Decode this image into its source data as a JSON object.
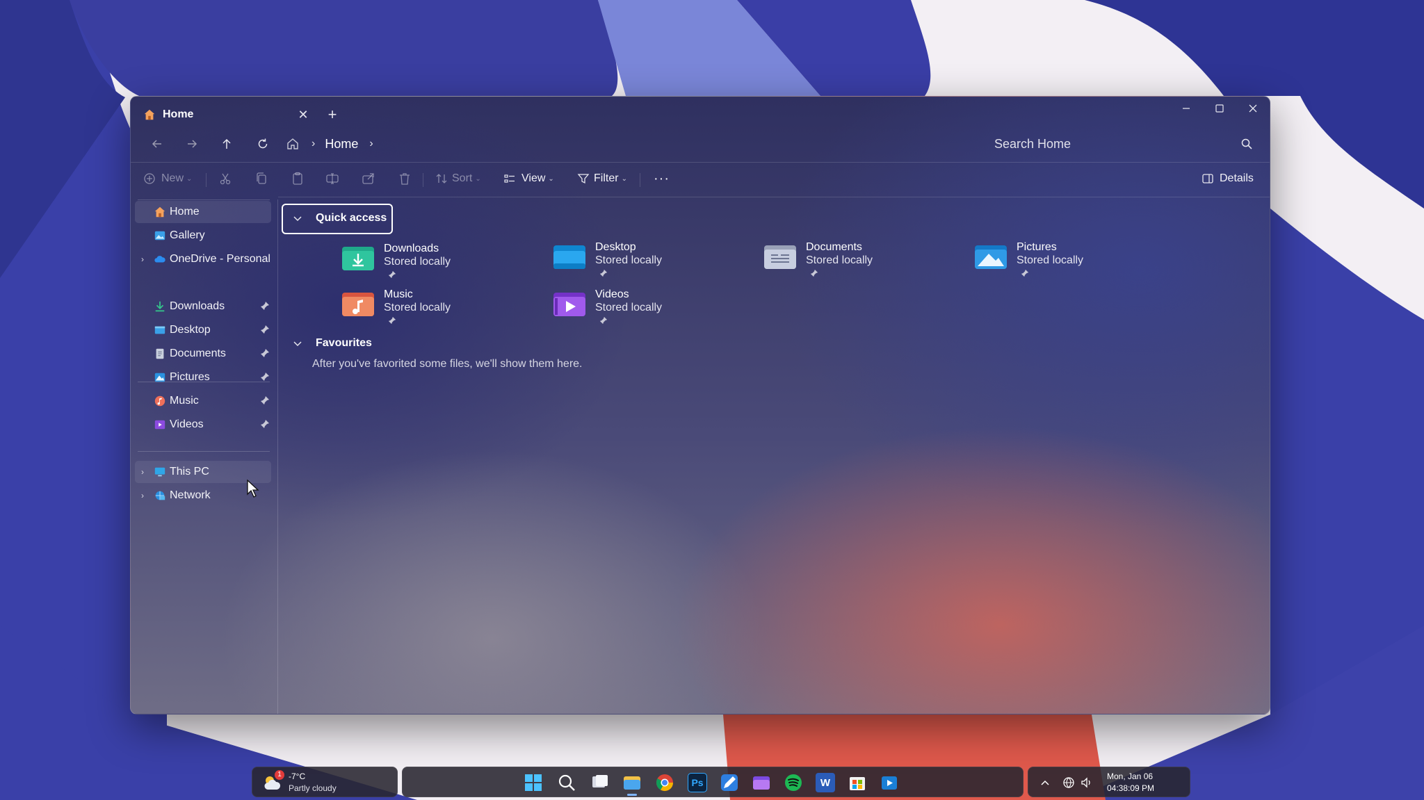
{
  "window": {
    "tab_title": "Home",
    "tab_close": "✕",
    "new_tab": "+",
    "minimize": "—",
    "maximize": "☐",
    "close": "✕"
  },
  "address": {
    "breadcrumb": [
      "Home"
    ],
    "search_placeholder": "Search Home"
  },
  "toolbar": {
    "new_label": "New",
    "sort_label": "Sort",
    "view_label": "View",
    "filter_label": "Filter",
    "more_label": "···",
    "details_label": "Details"
  },
  "sidebar": {
    "top": [
      {
        "label": "Home",
        "icon": "home-icon"
      },
      {
        "label": "Gallery",
        "icon": "gallery-icon"
      },
      {
        "label": "OneDrive - Personal",
        "icon": "onedrive-icon"
      }
    ],
    "pinned": [
      {
        "label": "Downloads",
        "icon": "downloads-icon"
      },
      {
        "label": "Desktop",
        "icon": "desktop-icon"
      },
      {
        "label": "Documents",
        "icon": "documents-icon"
      },
      {
        "label": "Pictures",
        "icon": "pictures-icon"
      },
      {
        "label": "Music",
        "icon": "music-icon"
      },
      {
        "label": "Videos",
        "icon": "videos-icon"
      }
    ],
    "bottom": [
      {
        "label": "This PC",
        "icon": "this-pc-icon"
      },
      {
        "label": "Network",
        "icon": "network-icon"
      }
    ]
  },
  "quick_access": {
    "title": "Quick access",
    "items": [
      {
        "name": "Downloads",
        "status": "Stored locally",
        "icon": "downloads-folder-icon"
      },
      {
        "name": "Desktop",
        "status": "Stored locally",
        "icon": "desktop-folder-icon"
      },
      {
        "name": "Documents",
        "status": "Stored locally",
        "icon": "documents-folder-icon"
      },
      {
        "name": "Pictures",
        "status": "Stored locally",
        "icon": "pictures-folder-icon"
      },
      {
        "name": "Music",
        "status": "Stored locally",
        "icon": "music-folder-icon"
      },
      {
        "name": "Videos",
        "status": "Stored locally",
        "icon": "videos-folder-icon"
      }
    ]
  },
  "favourites": {
    "title": "Favourites",
    "empty_text": "After you've favorited some files, we'll show them here."
  },
  "taskbar": {
    "weather_badge": "1",
    "weather_temp": "-7°C",
    "weather_condition": "Partly cloudy",
    "apps": [
      "start-icon",
      "search-icon",
      "task-view-icon",
      "file-explorer-icon",
      "chrome-icon",
      "photoshop-icon",
      "pen-app-icon",
      "folder-app-icon",
      "spotify-icon",
      "word-icon",
      "store-icon",
      "media-player-icon"
    ],
    "photoshop_label": "Ps",
    "word_label": "W",
    "date": "Mon, Jan 06",
    "time": "04:38:09 PM"
  }
}
